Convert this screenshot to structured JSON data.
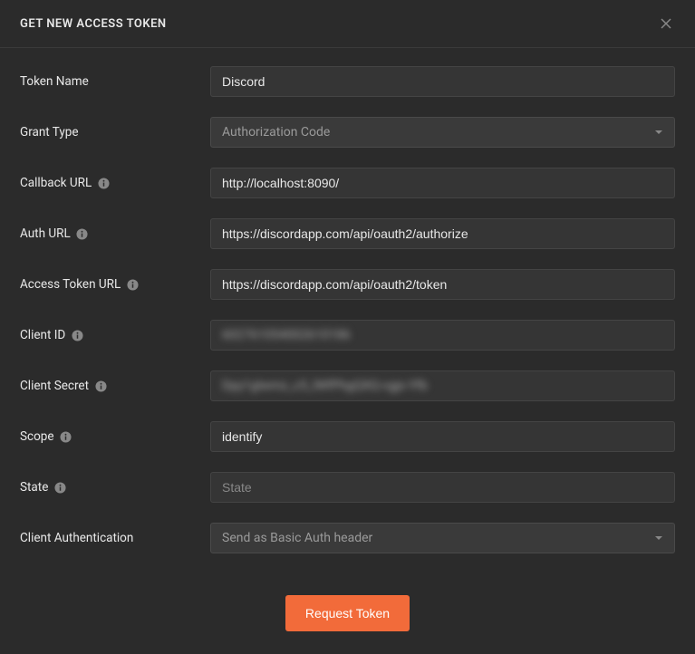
{
  "header": {
    "title": "GET NEW ACCESS TOKEN"
  },
  "form": {
    "tokenName": {
      "label": "Token Name",
      "value": "Discord"
    },
    "grantType": {
      "label": "Grant Type",
      "value": "Authorization Code"
    },
    "callbackUrl": {
      "label": "Callback URL",
      "value": "http://localhost:8090/"
    },
    "authUrl": {
      "label": "Auth URL",
      "value": "https://discordapp.com/api/oauth2/authorize"
    },
    "accessTokenUrl": {
      "label": "Access Token URL",
      "value": "https://discordapp.com/api/oauth2/token"
    },
    "clientId": {
      "label": "Client ID",
      "value": "602761054002610186"
    },
    "clientSecret": {
      "label": "Client Secret",
      "value": "Dpy1glwmz_c5_lWfPhgQXQ-vgjx-Yfb"
    },
    "scope": {
      "label": "Scope",
      "value": "identify"
    },
    "state": {
      "label": "State",
      "value": "",
      "placeholder": "State"
    },
    "clientAuth": {
      "label": "Client Authentication",
      "value": "Send as Basic Auth header"
    }
  },
  "footer": {
    "requestTokenLabel": "Request Token"
  }
}
